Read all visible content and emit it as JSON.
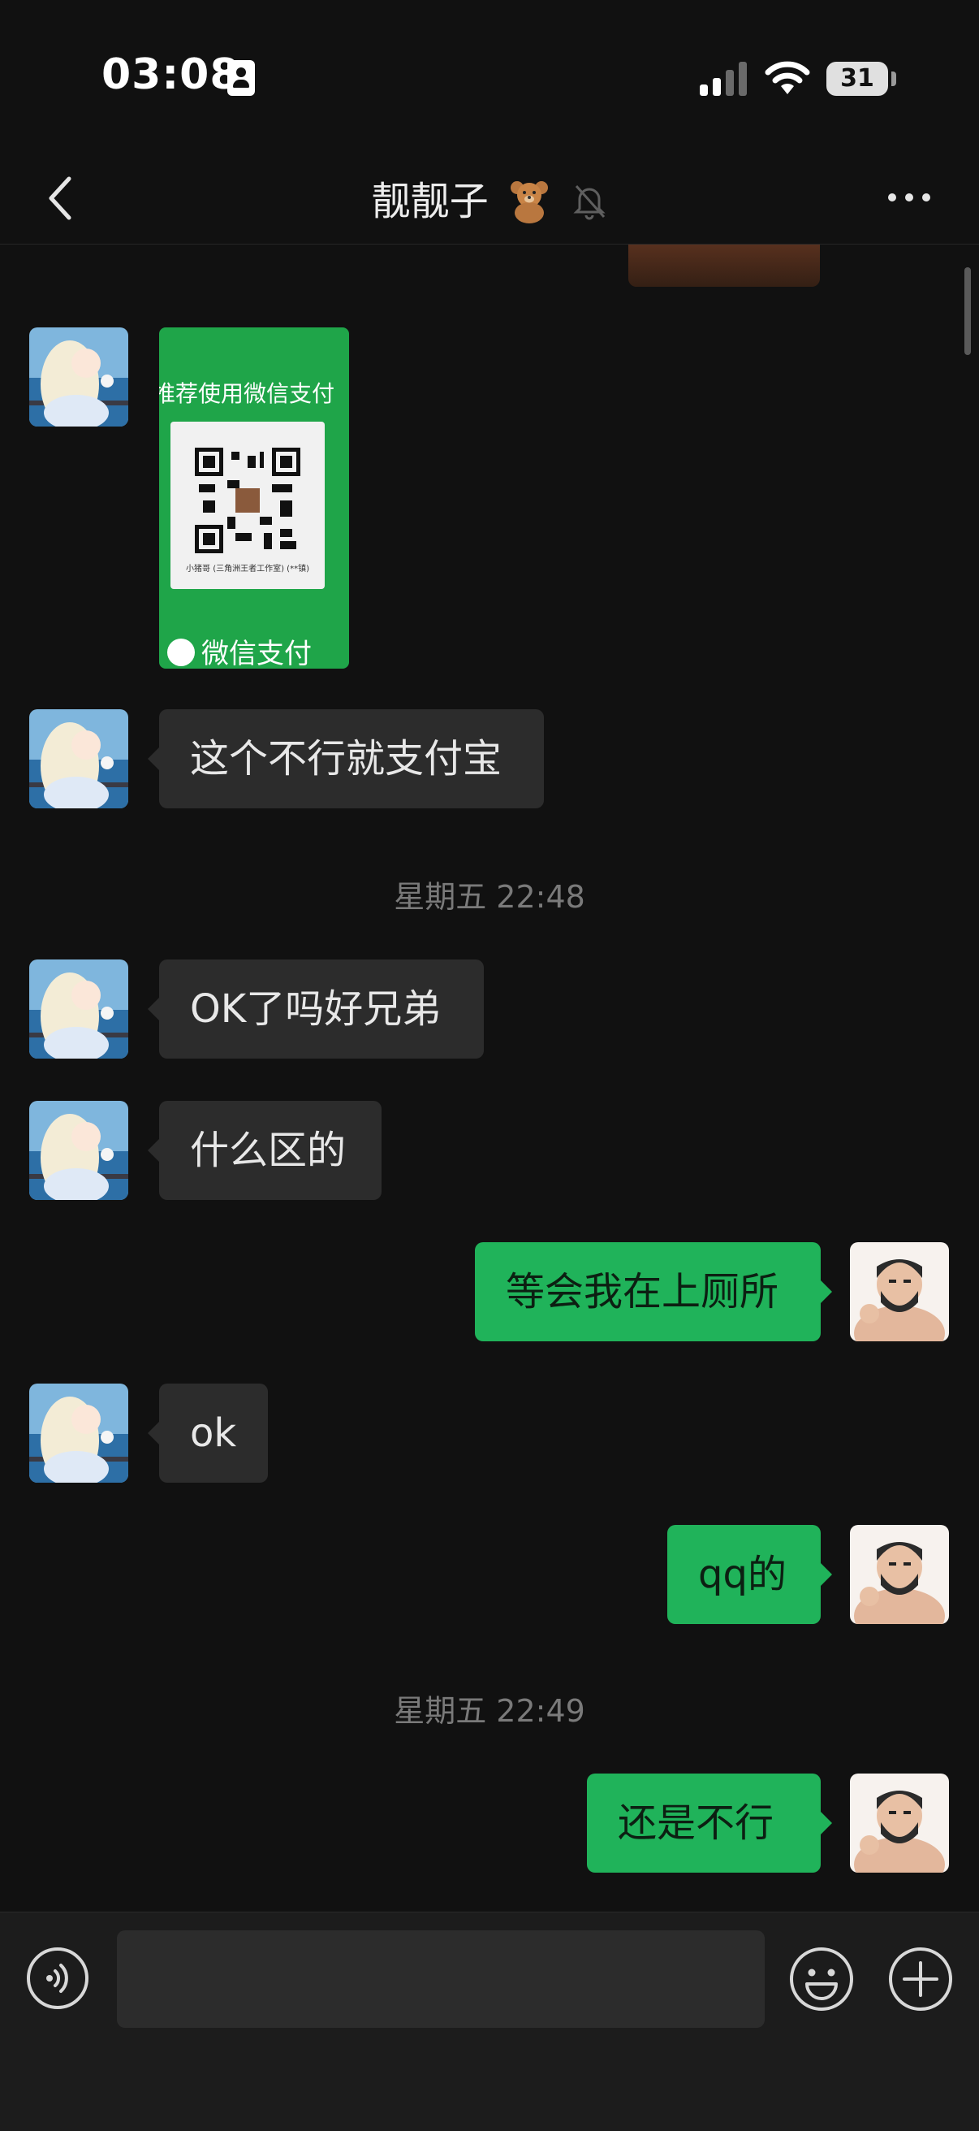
{
  "status_bar": {
    "time": "03:08",
    "battery": "31"
  },
  "nav": {
    "title": "靓靓子",
    "title_emoji": "🧸",
    "icons": [
      "back-chevron-icon",
      "muted-bell-icon",
      "more-dots-icon"
    ]
  },
  "messages": [
    {
      "type": "image",
      "side": "left",
      "image_text_top": "推荐使用微信支付",
      "image_text_caption": "小猪哥 (三角洲王者工作室) (**镇)",
      "image_text_bottom": "微信支付"
    },
    {
      "type": "text",
      "side": "left",
      "text": "这个不行就支付宝"
    },
    {
      "type": "timestamp",
      "text": "星期五 22:48"
    },
    {
      "type": "text",
      "side": "left",
      "text": "OK了吗好兄弟"
    },
    {
      "type": "text",
      "side": "left",
      "text": "什么区的"
    },
    {
      "type": "text",
      "side": "right",
      "text": "等会我在上厕所"
    },
    {
      "type": "text",
      "side": "left",
      "text": "ok"
    },
    {
      "type": "text",
      "side": "right",
      "text": "qq的"
    },
    {
      "type": "timestamp",
      "text": "星期五 22:49"
    },
    {
      "type": "text",
      "side": "right",
      "text": "还是不行"
    }
  ],
  "input_bar": {
    "placeholder": "",
    "icons": [
      "voice-icon",
      "emoji-icon",
      "plus-icon"
    ]
  },
  "colors": {
    "background": "#111111",
    "bubble_incoming": "#2c2c2c",
    "bubble_outgoing": "#20b35a",
    "timestamp": "#7a7a7a"
  }
}
